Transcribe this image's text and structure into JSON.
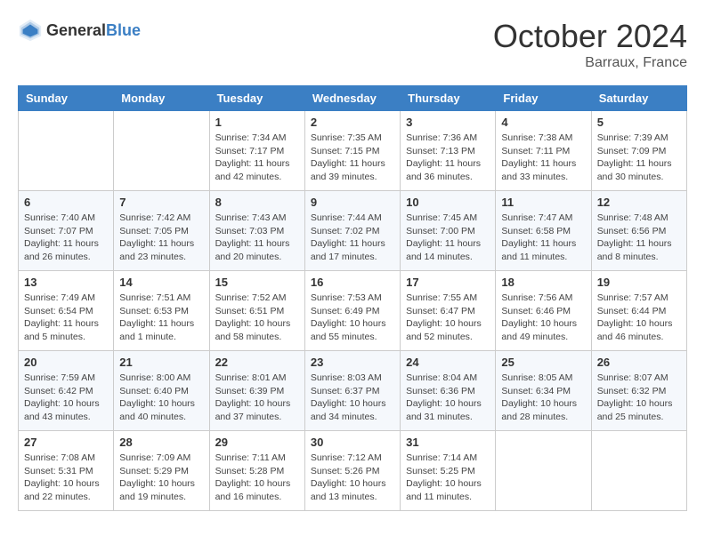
{
  "header": {
    "logo_general": "General",
    "logo_blue": "Blue",
    "month": "October 2024",
    "location": "Barraux, France"
  },
  "days_of_week": [
    "Sunday",
    "Monday",
    "Tuesday",
    "Wednesday",
    "Thursday",
    "Friday",
    "Saturday"
  ],
  "weeks": [
    [
      {
        "day": "",
        "content": ""
      },
      {
        "day": "",
        "content": ""
      },
      {
        "day": "1",
        "content": "Sunrise: 7:34 AM\nSunset: 7:17 PM\nDaylight: 11 hours and 42 minutes."
      },
      {
        "day": "2",
        "content": "Sunrise: 7:35 AM\nSunset: 7:15 PM\nDaylight: 11 hours and 39 minutes."
      },
      {
        "day": "3",
        "content": "Sunrise: 7:36 AM\nSunset: 7:13 PM\nDaylight: 11 hours and 36 minutes."
      },
      {
        "day": "4",
        "content": "Sunrise: 7:38 AM\nSunset: 7:11 PM\nDaylight: 11 hours and 33 minutes."
      },
      {
        "day": "5",
        "content": "Sunrise: 7:39 AM\nSunset: 7:09 PM\nDaylight: 11 hours and 30 minutes."
      }
    ],
    [
      {
        "day": "6",
        "content": "Sunrise: 7:40 AM\nSunset: 7:07 PM\nDaylight: 11 hours and 26 minutes."
      },
      {
        "day": "7",
        "content": "Sunrise: 7:42 AM\nSunset: 7:05 PM\nDaylight: 11 hours and 23 minutes."
      },
      {
        "day": "8",
        "content": "Sunrise: 7:43 AM\nSunset: 7:03 PM\nDaylight: 11 hours and 20 minutes."
      },
      {
        "day": "9",
        "content": "Sunrise: 7:44 AM\nSunset: 7:02 PM\nDaylight: 11 hours and 17 minutes."
      },
      {
        "day": "10",
        "content": "Sunrise: 7:45 AM\nSunset: 7:00 PM\nDaylight: 11 hours and 14 minutes."
      },
      {
        "day": "11",
        "content": "Sunrise: 7:47 AM\nSunset: 6:58 PM\nDaylight: 11 hours and 11 minutes."
      },
      {
        "day": "12",
        "content": "Sunrise: 7:48 AM\nSunset: 6:56 PM\nDaylight: 11 hours and 8 minutes."
      }
    ],
    [
      {
        "day": "13",
        "content": "Sunrise: 7:49 AM\nSunset: 6:54 PM\nDaylight: 11 hours and 5 minutes."
      },
      {
        "day": "14",
        "content": "Sunrise: 7:51 AM\nSunset: 6:53 PM\nDaylight: 11 hours and 1 minute."
      },
      {
        "day": "15",
        "content": "Sunrise: 7:52 AM\nSunset: 6:51 PM\nDaylight: 10 hours and 58 minutes."
      },
      {
        "day": "16",
        "content": "Sunrise: 7:53 AM\nSunset: 6:49 PM\nDaylight: 10 hours and 55 minutes."
      },
      {
        "day": "17",
        "content": "Sunrise: 7:55 AM\nSunset: 6:47 PM\nDaylight: 10 hours and 52 minutes."
      },
      {
        "day": "18",
        "content": "Sunrise: 7:56 AM\nSunset: 6:46 PM\nDaylight: 10 hours and 49 minutes."
      },
      {
        "day": "19",
        "content": "Sunrise: 7:57 AM\nSunset: 6:44 PM\nDaylight: 10 hours and 46 minutes."
      }
    ],
    [
      {
        "day": "20",
        "content": "Sunrise: 7:59 AM\nSunset: 6:42 PM\nDaylight: 10 hours and 43 minutes."
      },
      {
        "day": "21",
        "content": "Sunrise: 8:00 AM\nSunset: 6:40 PM\nDaylight: 10 hours and 40 minutes."
      },
      {
        "day": "22",
        "content": "Sunrise: 8:01 AM\nSunset: 6:39 PM\nDaylight: 10 hours and 37 minutes."
      },
      {
        "day": "23",
        "content": "Sunrise: 8:03 AM\nSunset: 6:37 PM\nDaylight: 10 hours and 34 minutes."
      },
      {
        "day": "24",
        "content": "Sunrise: 8:04 AM\nSunset: 6:36 PM\nDaylight: 10 hours and 31 minutes."
      },
      {
        "day": "25",
        "content": "Sunrise: 8:05 AM\nSunset: 6:34 PM\nDaylight: 10 hours and 28 minutes."
      },
      {
        "day": "26",
        "content": "Sunrise: 8:07 AM\nSunset: 6:32 PM\nDaylight: 10 hours and 25 minutes."
      }
    ],
    [
      {
        "day": "27",
        "content": "Sunrise: 7:08 AM\nSunset: 5:31 PM\nDaylight: 10 hours and 22 minutes."
      },
      {
        "day": "28",
        "content": "Sunrise: 7:09 AM\nSunset: 5:29 PM\nDaylight: 10 hours and 19 minutes."
      },
      {
        "day": "29",
        "content": "Sunrise: 7:11 AM\nSunset: 5:28 PM\nDaylight: 10 hours and 16 minutes."
      },
      {
        "day": "30",
        "content": "Sunrise: 7:12 AM\nSunset: 5:26 PM\nDaylight: 10 hours and 13 minutes."
      },
      {
        "day": "31",
        "content": "Sunrise: 7:14 AM\nSunset: 5:25 PM\nDaylight: 10 hours and 11 minutes."
      },
      {
        "day": "",
        "content": ""
      },
      {
        "day": "",
        "content": ""
      }
    ]
  ]
}
